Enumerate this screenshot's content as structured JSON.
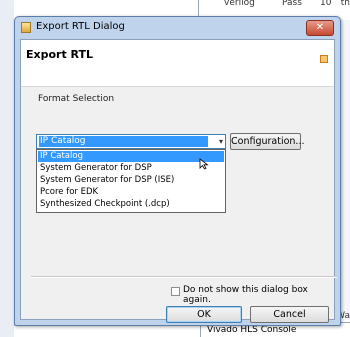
{
  "background": {
    "table_cells": [
      "verilog",
      "Pass",
      "10"
    ],
    "right_edge_text": "th",
    "right_strip_label": "Wa",
    "console_tab_label": "Vivado HLS Console"
  },
  "dialog": {
    "title": "Export RTL Dialog",
    "close_label": "✕",
    "header": "Export RTL",
    "section_label": "Format Selection",
    "format_combo": {
      "selected": "IP Catalog",
      "options": [
        "IP Catalog",
        "System Generator for DSP",
        "System Generator for DSP (ISE)",
        "Pcore for EDK",
        "Synthesized Checkpoint (.dcp)"
      ]
    },
    "configuration_button": "Configuration...",
    "do_not_show_label": "Do not show this dialog box again.",
    "ok_button": "OK",
    "cancel_button": "Cancel"
  },
  "icons": {
    "window_icon": "app-icon",
    "header_icon": "export-icon",
    "combo_arrow": "chevron-down-icon",
    "cursor": "mouse-pointer-icon"
  },
  "colors": {
    "selection": "#3399ff",
    "dialog_frame": "#bfd4ec",
    "close_button": "#c64a34"
  }
}
